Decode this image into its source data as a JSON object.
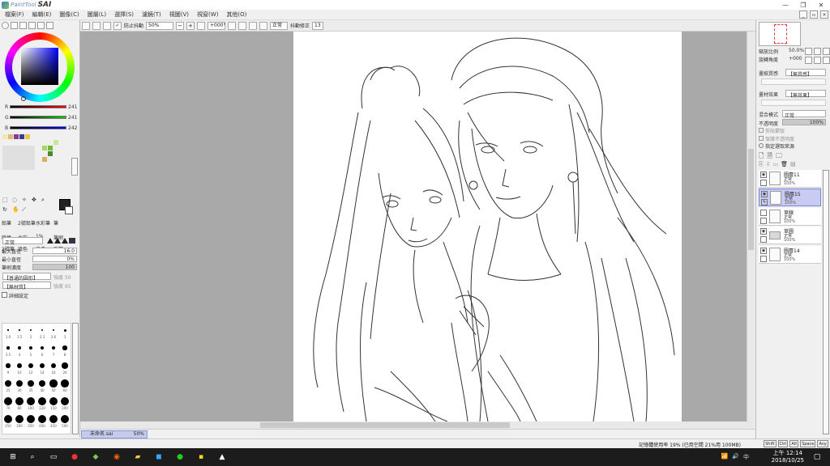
{
  "app": {
    "brand": "PaintTool",
    "name": "SAI"
  },
  "window": {
    "min": "—",
    "max": "❐",
    "close": "✕"
  },
  "menu": [
    "檔案(F)",
    "編輯(E)",
    "圖像(C)",
    "圖層(L)",
    "選擇(S)",
    "濾鏡(T)",
    "視圖(V)",
    "視窗(W)",
    "其他(O)"
  ],
  "toolbar": {
    "antialias_label": "防止抖動",
    "zoom_value": "50%",
    "angle_value": "+000°",
    "mode_value": "正常",
    "stabilizer_label": "抖動修正",
    "stabilizer_value": "13"
  },
  "color": {
    "r_label": "R",
    "r_value": "241",
    "g_label": "G",
    "g_value": "241",
    "b_label": "B",
    "b_value": "242"
  },
  "tools_panel": {
    "tools": [
      "鉛筆",
      "2號鉛筆",
      "水彩筆",
      "筆",
      "噴槍",
      "水彩",
      "1%",
      "筆刷",
      "2號筆",
      "填色",
      "橡皮",
      "毛筆"
    ],
    "mode_label": "正常",
    "max_size_label": "最大直徑",
    "max_size_value": "16.0",
    "min_size_label": "最小直徑",
    "min_size_value": "0%",
    "density_label": "筆刷濃度",
    "density_value": "100",
    "shape_label": "【普通的圓形】",
    "shape_strength": "強度 50",
    "texture_label": "【無材質】",
    "texture_strength": "強度 95",
    "detail_label": "詳細設定",
    "size_labels": [
      "1.0",
      "1.5",
      "2",
      "2.3",
      "2.6",
      "3",
      "3.5",
      "4",
      "5",
      "6",
      "7",
      "8",
      "9",
      "10",
      "12",
      "14",
      "16",
      "20",
      "25",
      "30",
      "35",
      "40",
      "50",
      "60",
      "70",
      "80",
      "100",
      "120",
      "150",
      "200",
      "250",
      "300",
      "350",
      "400",
      "450",
      "500"
    ]
  },
  "navigator": {
    "zoom_label": "縮放比例",
    "zoom_value": "50.0%",
    "angle_label": "旋轉角度",
    "angle_value": "+000"
  },
  "right_panel": {
    "texture_label": "畫紙質感",
    "texture_value": "【無質感】",
    "effect_label": "畫材效果",
    "effect_value": "【無效果】",
    "blend_label": "混合模式",
    "blend_value": "正常",
    "opacity_label": "不透明度",
    "opacity_value": "100%",
    "clip_label": "剪貼蒙版",
    "select_source_label": "指定選取來源",
    "lock_label": "保護不透明度"
  },
  "layers": [
    {
      "name": "圖層11",
      "mode": "正常",
      "opacity": "100%"
    },
    {
      "name": "圖層15",
      "mode": "正常",
      "opacity": "100%"
    },
    {
      "name": "草線",
      "mode": "正常",
      "opacity": "100%"
    },
    {
      "name": "草圖",
      "mode": "正常",
      "opacity": "100%"
    },
    {
      "name": "圖層14",
      "mode": "正常",
      "opacity": "100%"
    }
  ],
  "document": {
    "name": "未命名.sai",
    "zoom": "50%"
  },
  "status": {
    "memory": "記憶體使用率 19% (已用空間 21%用 100MB)",
    "tags": [
      "Shift",
      "Ctrl",
      "Alt",
      "Space",
      "Any"
    ]
  },
  "taskbar": {
    "time": "上午 12:14",
    "date": "2018/10/25"
  }
}
